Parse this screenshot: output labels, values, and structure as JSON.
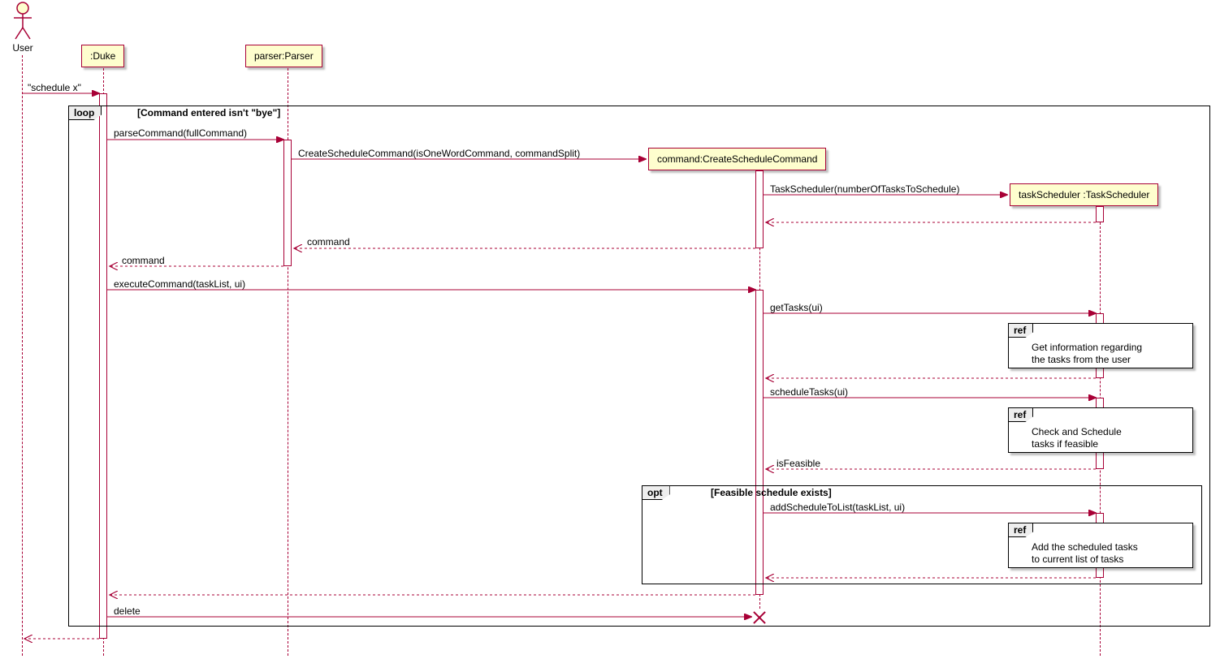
{
  "actors": {
    "user": {
      "label": "User"
    }
  },
  "participants": {
    "duke": {
      "label": ":Duke"
    },
    "parser": {
      "label": "parser:Parser"
    },
    "createScheduleCommand": {
      "label": "command:CreateScheduleCommand"
    },
    "taskScheduler": {
      "label": "taskScheduler :TaskScheduler"
    }
  },
  "fragments": {
    "loop": {
      "tag": "loop",
      "guard": "[Command entered isn't \"bye\"]"
    },
    "opt": {
      "tag": "opt",
      "guard": "[Feasible schedule exists]"
    }
  },
  "refs": {
    "getTasksRef": {
      "tag": "ref",
      "text1": "Get information regarding",
      "text2": "the tasks from the user"
    },
    "scheduleTasksRef": {
      "tag": "ref",
      "text1": "Check and Schedule",
      "text2": "tasks if feasible"
    },
    "addScheduleRef": {
      "tag": "ref",
      "text1": "Add the scheduled tasks",
      "text2": "to current list of tasks"
    }
  },
  "messages": {
    "m1": "\"schedule x\"",
    "m2": "parseCommand(fullCommand)",
    "m3": "CreateScheduleCommand(isOneWordCommand, commandSplit)",
    "m4": "TaskScheduler(numberOfTasksToSchedule)",
    "m5": "",
    "m6": "command",
    "m7": "command",
    "m8": "executeCommand(taskList, ui)",
    "m9": "getTasks(ui)",
    "m10": "",
    "m11": "scheduleTasks(ui)",
    "m12": "isFeasible",
    "m13": "addScheduleToList(taskList, ui)",
    "m14": "",
    "m15": "",
    "m16": "delete",
    "m17": ""
  },
  "chart_data": {
    "type": "uml-sequence-diagram",
    "actors": [
      "User"
    ],
    "participants": [
      ":Duke",
      "parser:Parser",
      "command:CreateScheduleCommand",
      "taskScheduler :TaskScheduler"
    ],
    "interactions": [
      {
        "from": "User",
        "to": ":Duke",
        "label": "\"schedule x\"",
        "style": "solid",
        "kind": "sync"
      },
      {
        "fragment": "loop",
        "guard": "Command entered isn't \"bye\"",
        "contains": [
          {
            "from": ":Duke",
            "to": "parser:Parser",
            "label": "parseCommand(fullCommand)",
            "style": "solid",
            "kind": "sync"
          },
          {
            "from": "parser:Parser",
            "to": "command:CreateScheduleCommand",
            "label": "CreateScheduleCommand(isOneWordCommand, commandSplit)",
            "style": "solid",
            "kind": "create"
          },
          {
            "from": "command:CreateScheduleCommand",
            "to": "taskScheduler :TaskScheduler",
            "label": "TaskScheduler(numberOfTasksToSchedule)",
            "style": "solid",
            "kind": "create"
          },
          {
            "from": "taskScheduler :TaskScheduler",
            "to": "command:CreateScheduleCommand",
            "label": "",
            "style": "dashed",
            "kind": "return"
          },
          {
            "from": "command:CreateScheduleCommand",
            "to": "parser:Parser",
            "label": "command",
            "style": "dashed",
            "kind": "return"
          },
          {
            "from": "parser:Parser",
            "to": ":Duke",
            "label": "command",
            "style": "dashed",
            "kind": "return"
          },
          {
            "from": ":Duke",
            "to": "command:CreateScheduleCommand",
            "label": "executeCommand(taskList, ui)",
            "style": "solid",
            "kind": "sync"
          },
          {
            "from": "command:CreateScheduleCommand",
            "to": "taskScheduler :TaskScheduler",
            "label": "getTasks(ui)",
            "style": "solid",
            "kind": "sync"
          },
          {
            "ref": "Get information regarding the tasks from the user",
            "over": [
              "taskScheduler :TaskScheduler"
            ]
          },
          {
            "from": "taskScheduler :TaskScheduler",
            "to": "command:CreateScheduleCommand",
            "label": "",
            "style": "dashed",
            "kind": "return"
          },
          {
            "from": "command:CreateScheduleCommand",
            "to": "taskScheduler :TaskScheduler",
            "label": "scheduleTasks(ui)",
            "style": "solid",
            "kind": "sync"
          },
          {
            "ref": "Check and Schedule tasks if feasible",
            "over": [
              "taskScheduler :TaskScheduler"
            ]
          },
          {
            "from": "taskScheduler :TaskScheduler",
            "to": "command:CreateScheduleCommand",
            "label": "isFeasible",
            "style": "dashed",
            "kind": "return"
          },
          {
            "fragment": "opt",
            "guard": "Feasible schedule exists",
            "contains": [
              {
                "from": "command:CreateScheduleCommand",
                "to": "taskScheduler :TaskScheduler",
                "label": "addScheduleToList(taskList, ui)",
                "style": "solid",
                "kind": "sync"
              },
              {
                "ref": "Add the scheduled tasks to current list of tasks",
                "over": [
                  "taskScheduler :TaskScheduler"
                ]
              },
              {
                "from": "taskScheduler :TaskScheduler",
                "to": "command:CreateScheduleCommand",
                "label": "",
                "style": "dashed",
                "kind": "return"
              }
            ]
          },
          {
            "from": "command:CreateScheduleCommand",
            "to": ":Duke",
            "label": "",
            "style": "dashed",
            "kind": "return"
          },
          {
            "from": ":Duke",
            "to": "command:CreateScheduleCommand",
            "label": "delete",
            "style": "solid",
            "kind": "destroy"
          }
        ]
      },
      {
        "from": ":Duke",
        "to": "User",
        "label": "",
        "style": "dashed",
        "kind": "return"
      }
    ]
  }
}
